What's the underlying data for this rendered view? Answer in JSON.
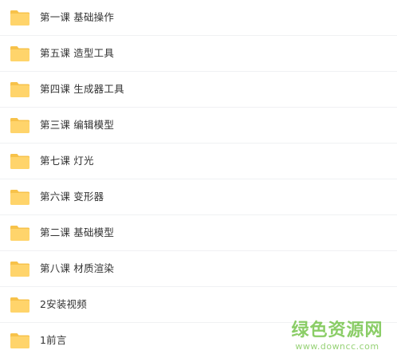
{
  "folders": [
    {
      "name": "第一课 基础操作",
      "icon": "folder-icon"
    },
    {
      "name": "第五课 造型工具",
      "icon": "folder-icon"
    },
    {
      "name": "第四课 生成器工具",
      "icon": "folder-icon"
    },
    {
      "name": "第三课 编辑模型",
      "icon": "folder-icon"
    },
    {
      "name": "第七课 灯光",
      "icon": "folder-icon"
    },
    {
      "name": "第六课 变形器",
      "icon": "folder-icon"
    },
    {
      "name": "第二课 基础模型",
      "icon": "folder-icon"
    },
    {
      "name": "第八课 材质渲染",
      "icon": "folder-icon"
    },
    {
      "name": "2安装视频",
      "icon": "folder-icon"
    },
    {
      "name": "1前言",
      "icon": "folder-icon"
    }
  ],
  "watermark": {
    "logo_text": "绿色资源网",
    "url_text": "www.downcc.com"
  },
  "colors": {
    "folder_fill": "#ffd46b",
    "folder_tab": "#f7c24a",
    "text": "#333333",
    "divider": "#f0f1f3",
    "watermark_green": "#6abf3c"
  }
}
